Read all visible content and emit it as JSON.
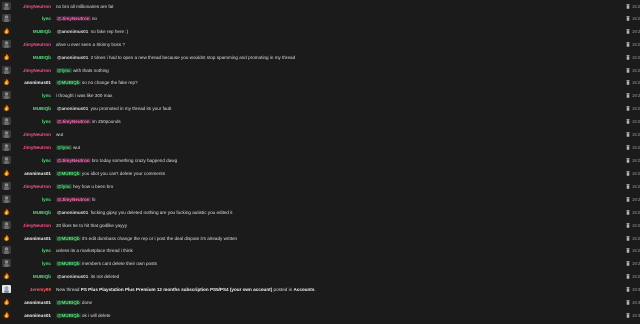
{
  "messages": [
    {
      "user": "JimyNeutron",
      "role": "pink",
      "avatar": "dark",
      "text": "no bro all millionaires are fat",
      "time": "19:2"
    },
    {
      "user": "lync",
      "role": "green",
      "avatar": "dark",
      "mention": "@JimyNeutron",
      "mention_color": "pink",
      "text": "no",
      "time": "19:2"
    },
    {
      "user": "MUBIQb",
      "role": "green",
      "avatar": "fire",
      "mention": "@anonimus01",
      "mention_color": "none",
      "text": "no fake rep here :)",
      "time": "19:2"
    },
    {
      "user": "JimyNeutron",
      "role": "pink",
      "avatar": "dark",
      "text": "ahve u ever seen a Skinny boss ?",
      "time": "19:2"
    },
    {
      "user": "MUBIQb",
      "role": "green",
      "avatar": "fire",
      "mention": "@anonimus01",
      "mention_color": "none",
      "text": "2 times i had to open a new thread because you wouldnt stop spamming and promoting in my thread",
      "time": "19:2"
    },
    {
      "user": "JimyNeutron",
      "role": "pink",
      "avatar": "dark",
      "mention": "@lync",
      "mention_color": "green",
      "text": "with thats nothing",
      "time": "19:2"
    },
    {
      "user": "anonimus01",
      "role": "white",
      "avatar": "fire",
      "mention": "@MUBIQb",
      "mention_color": "green",
      "text": "so no change the fake rep?",
      "time": "19:2"
    },
    {
      "user": "lync",
      "role": "green",
      "avatar": "dark",
      "text": "i thought i was like 300 max",
      "time": "19:2"
    },
    {
      "user": "MUBIQb",
      "role": "green",
      "avatar": "fire",
      "mention": "@anonimus01",
      "mention_color": "none",
      "text": "you promoted in my thread its your fault",
      "time": "19:2"
    },
    {
      "user": "lync",
      "role": "green",
      "avatar": "dark",
      "mention": "@JimyNeutron",
      "mention_color": "pink",
      "text": "im 250pounds",
      "time": "19:2"
    },
    {
      "user": "JimyNeutron",
      "role": "pink",
      "avatar": "dark",
      "text": "wut",
      "time": "19:2"
    },
    {
      "user": "JimyNeutron",
      "role": "pink",
      "avatar": "dark",
      "mention": "@lync",
      "mention_color": "green",
      "text": "wut",
      "time": "19:2"
    },
    {
      "user": "lync",
      "role": "green",
      "avatar": "dark",
      "mention": "@JimyNeutron",
      "mention_color": "pink",
      "text": "bro today something crazy happend dawg",
      "time": "19:2"
    },
    {
      "user": "anonimus01",
      "role": "white",
      "avatar": "fire",
      "mention": "@MUBIQb",
      "mention_color": "green",
      "text": "you idiot you can't delete your comments",
      "time": "19:2"
    },
    {
      "user": "JimyNeutron",
      "role": "pink",
      "avatar": "dark",
      "mention": "@lync",
      "mention_color": "green",
      "text": "hey how u been bro",
      "time": "19:2"
    },
    {
      "user": "lync",
      "role": "green",
      "avatar": "dark",
      "mention": "@JimyNeutron",
      "mention_color": "pink",
      "text": "hi",
      "time": "19:2"
    },
    {
      "user": "MUBIQb",
      "role": "green",
      "avatar": "fire",
      "mention": "@anonimus01",
      "mention_color": "none",
      "text": "fucking gipsy you deleted nothing are you fucking autistic you edited it",
      "time": "19:2"
    },
    {
      "user": "JimyNeutron",
      "role": "pink",
      "avatar": "dark",
      "text": "20 likes 5e to hit that godlike yayyy",
      "time": "19:2"
    },
    {
      "user": "anonimus01",
      "role": "white",
      "avatar": "fire",
      "mention": "@MUBIQb",
      "mention_color": "green",
      "text": "it's edit dumbass change the rep or i post the deal dispute it's already written",
      "time": "19:2"
    },
    {
      "user": "lync",
      "role": "green",
      "avatar": "dark",
      "text": "unless its a marketplace thread i think",
      "time": "19:2"
    },
    {
      "user": "lync",
      "role": "green",
      "avatar": "dark",
      "mention": "@MUBIQb",
      "mention_color": "green",
      "text": "members cant delete their own posts",
      "time": "19:2"
    },
    {
      "user": "MUBIQb",
      "role": "green",
      "avatar": "fire",
      "mention": "@anonimus01",
      "mention_color": "none",
      "text": "its not deleted",
      "time": "19:2"
    },
    {
      "user": "Jeremy89",
      "role": "red",
      "avatar": "pale",
      "system": true,
      "text_pre": "New thread",
      "thread_title": "PS Plus Playstation Plus Premium 12 months subscription PS5/PS4 (your own account)",
      "text_mid": "posted in",
      "forum": "Accounts",
      "text_end": ".",
      "time": "19:3"
    },
    {
      "user": "anonimus01",
      "role": "white",
      "avatar": "fire",
      "mention": "@MUBIQb",
      "mention_color": "green",
      "text": "done",
      "time": "19:3"
    },
    {
      "user": "anonimus01",
      "role": "white",
      "avatar": "fire",
      "mention": "@MUBIQb",
      "mention_color": "green",
      "text": "ok i will delete",
      "time": "19:3"
    }
  ],
  "colors": {
    "background": "#1b1b1b",
    "pink": "#ff4f8f",
    "green": "#55e07a",
    "red": "#ff5a5a",
    "white": "#f0f0f0",
    "delete_icon": "#b8b8b8"
  },
  "icons": {
    "delete": "trash-icon",
    "avatar_fire": "flame-avatar",
    "avatar_dark": "dark-avatar",
    "avatar_pale": "pale-avatar"
  }
}
